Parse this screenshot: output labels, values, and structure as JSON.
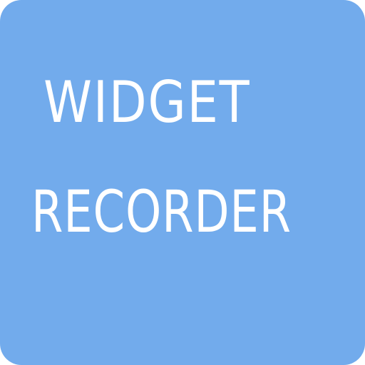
{
  "app_icon": {
    "background_color": "#72abec",
    "text_color": "#ffffff",
    "title_line_1": "WIDGET",
    "title_line_2": "RECORDER"
  }
}
